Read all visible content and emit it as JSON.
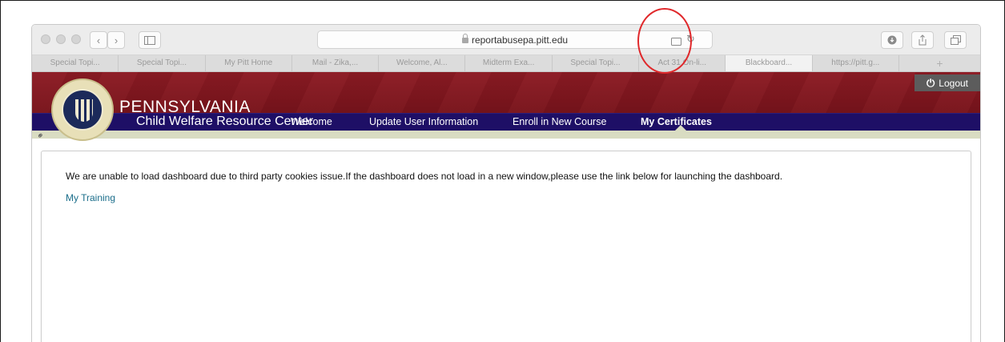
{
  "browser": {
    "url": "reportabusepa.pitt.edu",
    "tabs": [
      {
        "label": "Special Topi..."
      },
      {
        "label": "Special Topi..."
      },
      {
        "label": "My Pitt Home"
      },
      {
        "label": "Mail - Zika,..."
      },
      {
        "label": "Welcome, Al..."
      },
      {
        "label": "Midterm Exa..."
      },
      {
        "label": "Special Topi..."
      },
      {
        "label": "Act 31 On-li..."
      },
      {
        "label": "Blackboard..."
      },
      {
        "label": "https://pitt.g..."
      }
    ],
    "add_tab": "+"
  },
  "site": {
    "brand_title": "PENNSYLVANIA",
    "brand_subtitle": "Child Welfare Resource Center",
    "logout_label": "Logout",
    "nav": [
      {
        "label": "Welcome"
      },
      {
        "label": "Update User Information"
      },
      {
        "label": "Enroll in New Course"
      },
      {
        "label": "My Certificates"
      }
    ]
  },
  "content": {
    "notice": "We are unable to load dashboard due to third party cookies issue.If the dashboard does not load in a new window,please use the link below for launching the dashboard.",
    "link": "My Training"
  },
  "colors": {
    "header_maroon": "#7a141c",
    "nav_navy": "#1e0f66",
    "link_teal": "#1a6d8a",
    "annotation_red": "#e0282b"
  }
}
